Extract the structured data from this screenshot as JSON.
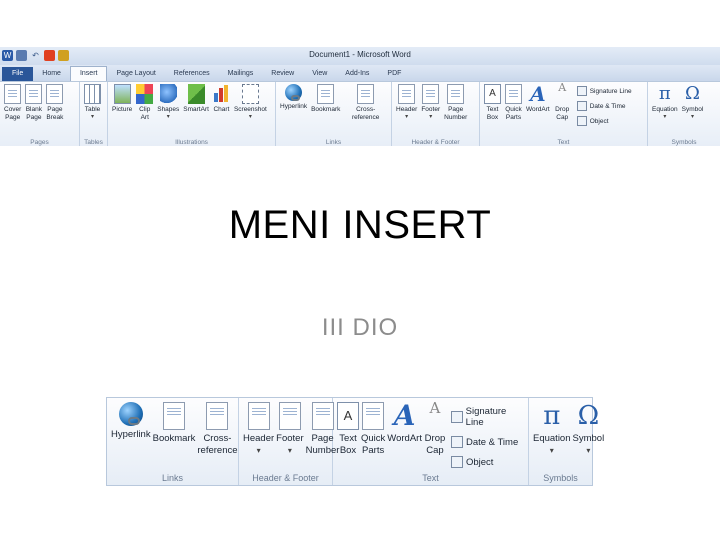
{
  "window": {
    "title": "Document1 - Microsoft Word"
  },
  "tabs": [
    "File",
    "Home",
    "Insert",
    "Page Layout",
    "References",
    "Mailings",
    "Review",
    "View",
    "Add-Ins",
    "PDF"
  ],
  "active_tab": "Insert",
  "groups": {
    "pages": {
      "label": "Pages",
      "buttons": [
        [
          "Cover",
          "Page"
        ],
        [
          "Blank",
          "Page"
        ],
        [
          "Page",
          "Break"
        ]
      ]
    },
    "tables": {
      "label": "Tables",
      "buttons": [
        [
          "Table",
          ""
        ]
      ]
    },
    "illustrations": {
      "label": "Illustrations",
      "buttons": [
        [
          "Picture",
          ""
        ],
        [
          "Clip",
          "Art"
        ],
        [
          "Shapes",
          ""
        ],
        [
          "SmartArt",
          ""
        ],
        [
          "Chart",
          ""
        ],
        [
          "Screenshot",
          ""
        ]
      ]
    },
    "links": {
      "label": "Links",
      "buttons": [
        [
          "Hyperlink",
          ""
        ],
        [
          "Bookmark",
          ""
        ],
        [
          "Cross-reference",
          ""
        ]
      ]
    },
    "header_footer": {
      "label": "Header & Footer",
      "buttons": [
        [
          "Header",
          ""
        ],
        [
          "Footer",
          ""
        ],
        [
          "Page",
          "Number"
        ]
      ]
    },
    "text": {
      "label": "Text",
      "buttons": [
        [
          "Text",
          "Box"
        ],
        [
          "Quick",
          "Parts"
        ],
        [
          "WordArt",
          ""
        ],
        [
          "Drop",
          "Cap"
        ]
      ],
      "small": [
        "Signature Line",
        "Date & Time",
        "Object"
      ]
    },
    "symbols": {
      "label": "Symbols",
      "buttons": [
        [
          "Equation",
          ""
        ],
        [
          "Symbol",
          ""
        ]
      ]
    }
  },
  "slide": {
    "title": "MENI INSERT",
    "subtitle": "III DIO"
  },
  "icons": {
    "equation": "π",
    "symbol": "Ω",
    "wordart": "A",
    "dropcap": "A",
    "textbox": "A"
  },
  "colors": {
    "file_tab": "#2a5699",
    "ribbon_bg": "#e7eef7",
    "title": "#000000",
    "subtitle": "#8c8c8c"
  }
}
